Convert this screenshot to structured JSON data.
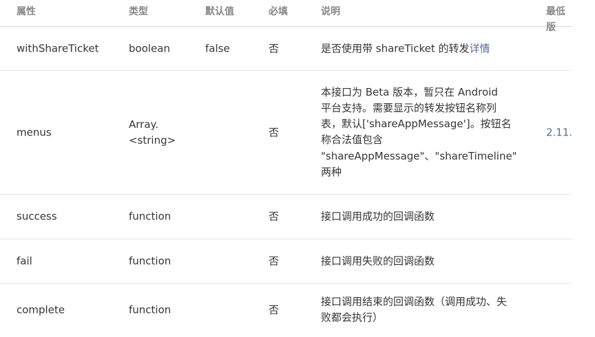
{
  "header": {
    "col_property": "属性",
    "col_type": "类型",
    "col_default": "默认值",
    "col_required": "必填",
    "col_desc": "说明",
    "col_min_version": "最低版"
  },
  "rows": [
    {
      "property": "withShareTicket",
      "type": "boolean",
      "default": "false",
      "required": "否",
      "desc_prefix": "是否使用带 shareTicket 的转发",
      "desc_link": "详情",
      "min_version": ""
    },
    {
      "property": "menus",
      "type_line1": "Array.",
      "type_line2": "<string>",
      "default": "",
      "required": "否",
      "desc_lines": [
        "本接口为 Beta 版本，暂只在 Android",
        "平台支持。需要显示的转发按钮名称列",
        "表，默认['shareAppMessage']。按钮名",
        "称合法值包含",
        "\"shareAppMessage\"、\"shareTimeline\"",
        "两种"
      ],
      "min_version": "2.11."
    },
    {
      "property": "success",
      "type": "function",
      "default": "",
      "required": "否",
      "desc": "接口调用成功的回调函数",
      "min_version": ""
    },
    {
      "property": "fail",
      "type": "function",
      "default": "",
      "required": "否",
      "desc": "接口调用失败的回调函数",
      "min_version": ""
    },
    {
      "property": "complete",
      "type": "function",
      "default": "",
      "required": "否",
      "desc_line1": "接口调用结束的回调函数（调用成功、失",
      "desc_line2": "败都会执行）",
      "min_version": ""
    }
  ],
  "colors": {
    "text": "#353535",
    "header_text": "#888888",
    "link": "#576b95",
    "divider": "#e5e5e5"
  }
}
